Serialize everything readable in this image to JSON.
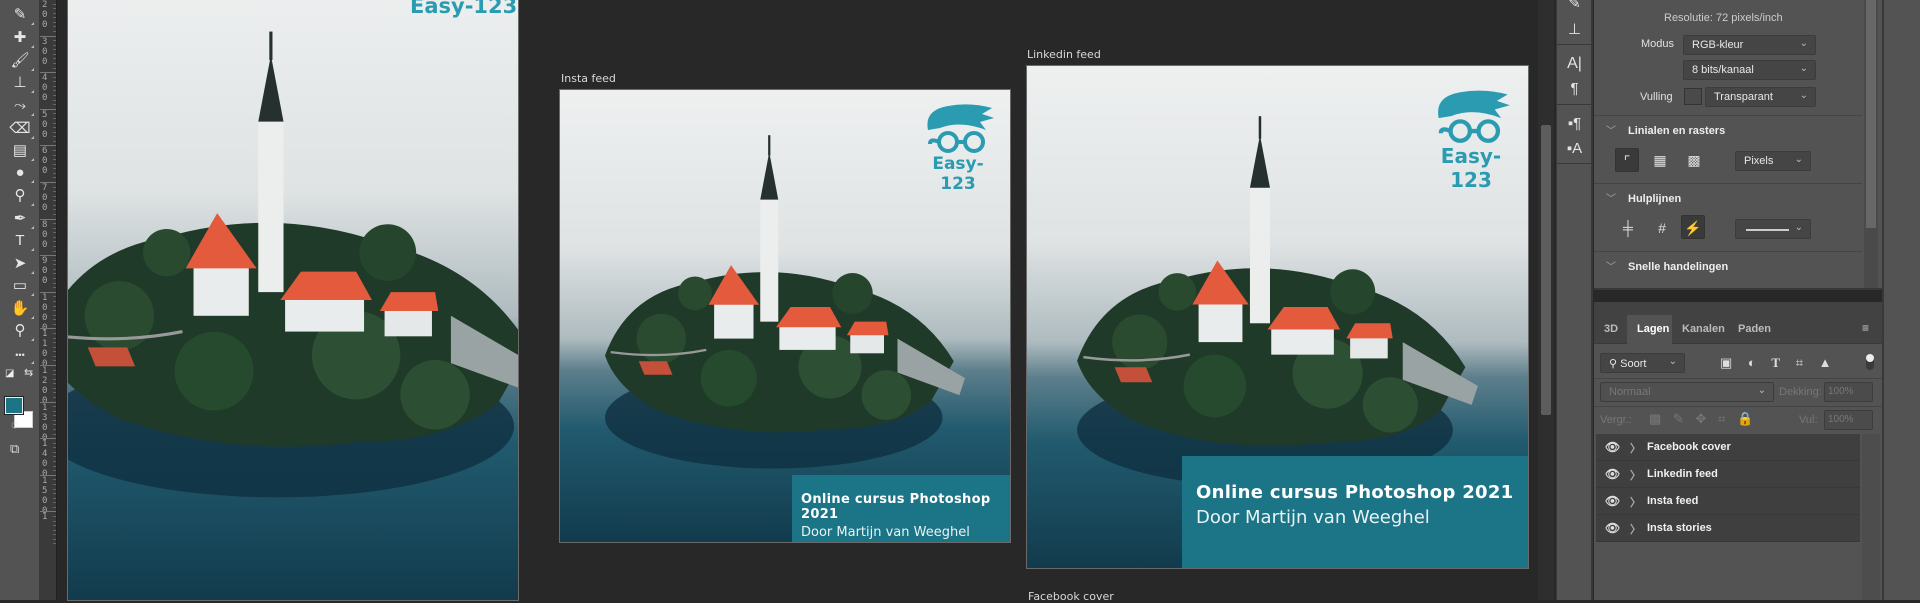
{
  "toolbar": {
    "tools": [
      {
        "name": "eyedropper-tool",
        "icon": "eyedropper-icon",
        "glyph": "✎"
      },
      {
        "name": "healing-brush-tool",
        "icon": "bandage-icon",
        "glyph": "✚"
      },
      {
        "name": "brush-tool",
        "icon": "brush-icon",
        "glyph": "🖌"
      },
      {
        "name": "clone-stamp-tool",
        "icon": "stamp-icon",
        "glyph": "⊥"
      },
      {
        "name": "history-brush-tool",
        "icon": "history-brush-icon",
        "glyph": "⤳"
      },
      {
        "name": "eraser-tool",
        "icon": "eraser-icon",
        "glyph": "⌫"
      },
      {
        "name": "gradient-tool",
        "icon": "gradient-icon",
        "glyph": "▤"
      },
      {
        "name": "blur-tool",
        "icon": "drop-icon",
        "glyph": "●"
      },
      {
        "name": "dodge-tool",
        "icon": "dodge-icon",
        "glyph": "⚲"
      },
      {
        "name": "pen-tool",
        "icon": "pen-icon",
        "glyph": "✒"
      },
      {
        "name": "type-tool",
        "icon": "type-icon",
        "glyph": "T"
      },
      {
        "name": "path-selection-tool",
        "icon": "arrow-icon",
        "glyph": "➤"
      },
      {
        "name": "rectangle-tool",
        "icon": "rectangle-icon",
        "glyph": "▭"
      },
      {
        "name": "hand-tool",
        "icon": "hand-icon",
        "glyph": "✋"
      },
      {
        "name": "zoom-tool",
        "icon": "magnifier-icon",
        "glyph": "⚲"
      },
      {
        "name": "more-tools",
        "icon": "ellipsis-icon",
        "glyph": "•••"
      }
    ],
    "foreground_color": "#1c7487",
    "background_color": "#ffffff"
  },
  "ruler": {
    "labels": [
      "200",
      "300",
      "400",
      "500",
      "600",
      "700",
      "800",
      "900",
      "1000",
      "1100",
      "1200",
      "1300",
      "1400",
      "1500",
      "1"
    ]
  },
  "artboards": {
    "insta_stories": {
      "logo_text": "Easy-123"
    },
    "insta_feed": {
      "label": "Insta feed",
      "logo_text": "Easy-123",
      "title": "Online cursus Photoshop 2021",
      "subtitle": "Door Martijn van Weeghel"
    },
    "linkedin_feed": {
      "label": "Linkedin feed",
      "logo_text": "Easy-123",
      "title": "Online cursus Photoshop 2021",
      "subtitle": "Door Martijn van Weeghel"
    },
    "facebook_cover": {
      "label": "Facebook cover"
    }
  },
  "colors": {
    "brand_teal": "#1c7487",
    "logo_teal": "#2a9bb0",
    "canvas_bg": "#282828",
    "panel_bg": "#535353"
  },
  "properties": {
    "resolution": "Resolutie: 72 pixels/inch",
    "mode_label": "Modus",
    "mode_value": "RGB-kleur",
    "depth_value": "8 bits/kanaal",
    "fill_label": "Vulling",
    "fill_value": "Transparant",
    "rulers_section": "Linialen en rasters",
    "units_value": "Pixels",
    "guides_section": "Hulplijnen",
    "quick_actions_section": "Snelle handelingen"
  },
  "layers_panel": {
    "tabs": [
      "3D",
      "Lagen",
      "Kanalen",
      "Paden"
    ],
    "active_tab": "Lagen",
    "filter_value": "Soort",
    "blend_mode": "Normaal",
    "opacity_label": "Dekking:",
    "opacity_value": "100%",
    "lock_label": "Vergr.:",
    "fill_label": "Vul:",
    "fill_value": "100%",
    "layers": [
      {
        "name": "Facebook cover",
        "visible": true
      },
      {
        "name": "Linkedin feed",
        "visible": true
      },
      {
        "name": "Insta feed",
        "visible": true
      },
      {
        "name": "Insta stories",
        "visible": true
      }
    ]
  }
}
